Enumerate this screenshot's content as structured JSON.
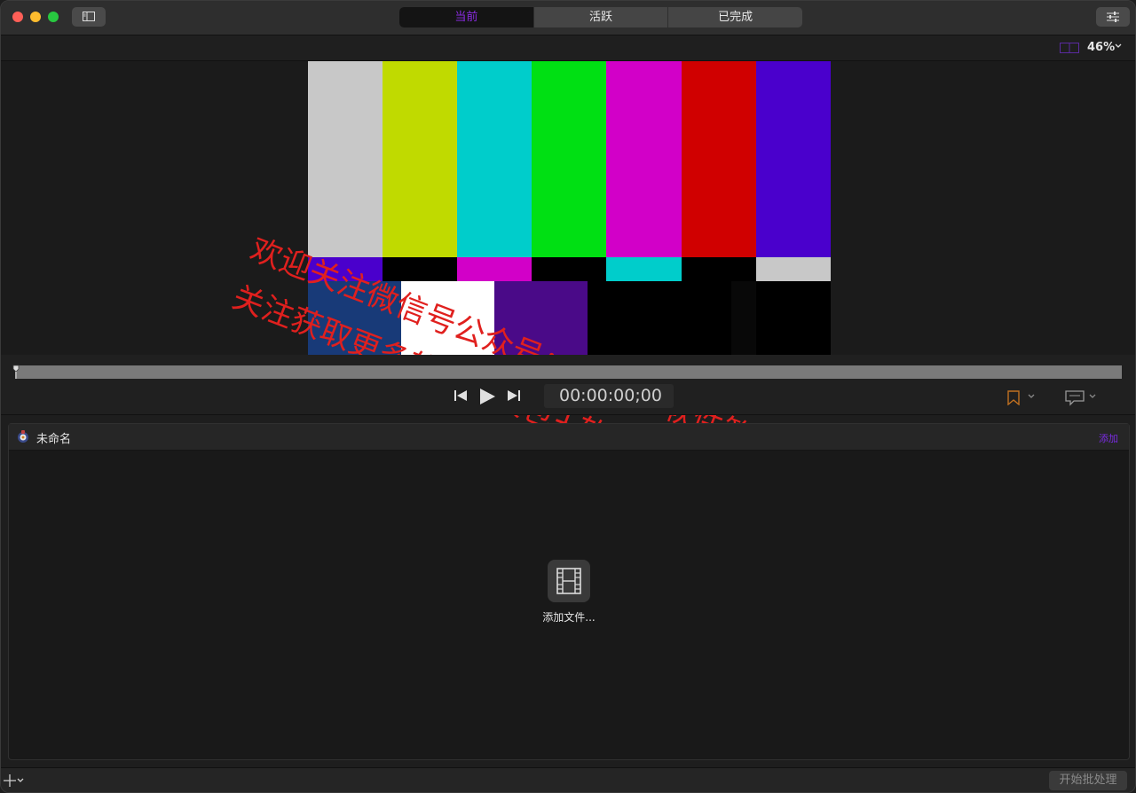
{
  "titlebar": {
    "tabs": [
      {
        "label": "当前",
        "active": true
      },
      {
        "label": "活跃",
        "active": false
      },
      {
        "label": "已完成",
        "active": false
      }
    ],
    "sidebar_toggle_icon": "sidebar-icon",
    "inspector_icon": "sliders-icon"
  },
  "viewer_toolbar": {
    "zoom": "46%",
    "view_icon": "view-layout-icon"
  },
  "viewer": {
    "test_pattern": "color-bars",
    "watermark_line1": "欢迎关注微信号公众号：Macku软件管家！",
    "watermark_line2": "关注获取更多软件安装包+软件安装教程！"
  },
  "transport": {
    "timecode": "00:00:00;00",
    "prev_icon": "skip-back-icon",
    "play_icon": "play-icon",
    "next_icon": "skip-forward-icon",
    "marker_icon": "bookmark-icon",
    "comment_icon": "comment-icon"
  },
  "batch": {
    "title": "未命名",
    "add_label": "添加",
    "add_files_label": "添加文件..."
  },
  "bottom_bar": {
    "start_batch_label": "开始批处理",
    "add_icon": "plus-icon"
  },
  "colors": {
    "accent": "#8a2be2",
    "marker": "#c07020"
  }
}
